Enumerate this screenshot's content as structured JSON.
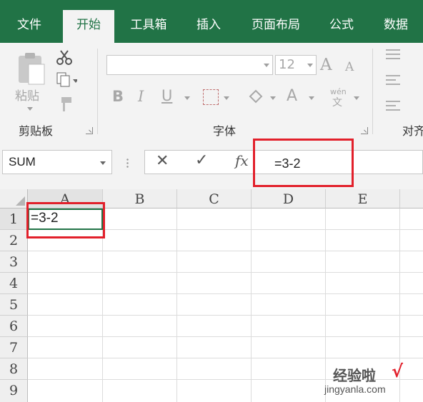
{
  "tabs": [
    "文件",
    "开始",
    "工具箱",
    "插入",
    "页面布局",
    "公式",
    "数据"
  ],
  "ribbon": {
    "clipboard": {
      "paste_label": "粘贴",
      "group_label": "剪贴板"
    },
    "font": {
      "font_name_value": "",
      "font_size_value": "12",
      "group_label": "字体",
      "bold": "B",
      "italic": "I",
      "underline": "U",
      "font_color": "A",
      "grow": "A",
      "shrink": "A",
      "phonetic_top": "wén",
      "phonetic_bottom": "文"
    },
    "alignment": {
      "group_label_partial": "对齐"
    }
  },
  "formula_bar": {
    "name_box_value": "SUM",
    "cancel_icon": "✕",
    "enter_icon": "✓",
    "fx_label": "fx",
    "formula_value": "=3-2"
  },
  "grid": {
    "columns": [
      "A",
      "B",
      "C",
      "D",
      "E"
    ],
    "rows": [
      "1",
      "2",
      "3",
      "4",
      "5",
      "6",
      "7",
      "8",
      "9"
    ],
    "cell_A1": "=3-2"
  },
  "watermark": {
    "site_cn": "经验啦",
    "check": "√",
    "site_url": "jingyanla.com"
  },
  "colors": {
    "ribbon_green": "#217346",
    "highlight_red": "#e2202b"
  }
}
